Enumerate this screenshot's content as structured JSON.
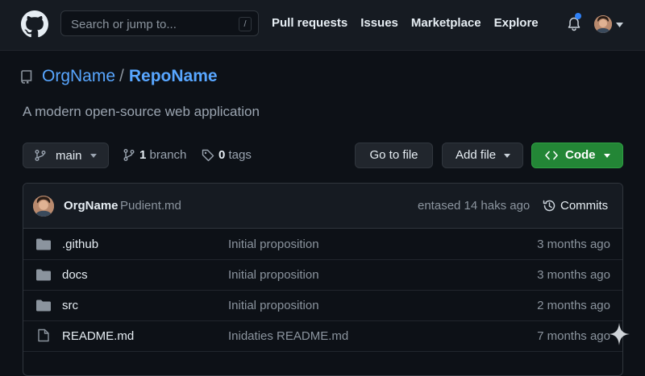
{
  "topbar": {
    "search_placeholder": "Search or jump to...",
    "search_shortcut": "/",
    "nav": [
      "Pull requests",
      "Issues",
      "Marketplace",
      "Explore"
    ]
  },
  "repo": {
    "owner": "OrgName",
    "separator": "/",
    "name": "RepoName",
    "description": "A modern open-source web application"
  },
  "toolbar": {
    "branch": "main",
    "branch_count": "1",
    "branch_label": "branch",
    "tag_count": "0",
    "tag_label": "tags",
    "go_to_file": "Go to file",
    "add_file": "Add file",
    "code": "Code"
  },
  "commit": {
    "author": "OrgName",
    "message": "Pudient.md",
    "time": "entased 14 haks ago",
    "commits_link": "Commits"
  },
  "files": [
    {
      "name": ".github",
      "type": "folder",
      "message": "Initial proposition",
      "age": "3 months ago"
    },
    {
      "name": "docs",
      "type": "folder",
      "message": "Initial proposition",
      "age": "3 months ago"
    },
    {
      "name": "src",
      "type": "folder",
      "message": "Initial proposition",
      "age": "2 months ago"
    },
    {
      "name": "README.md",
      "type": "file",
      "message": "Inidaties README.md",
      "age": "7 months ago"
    }
  ],
  "colors": {
    "background": "#0d1117",
    "link": "#58a6ff",
    "code_button": "#238636",
    "notification_dot": "#2f81f7"
  },
  "icons": {
    "logo": "github-logo-icon",
    "bell": "bell-icon",
    "repo": "repo-icon",
    "branch": "git-branch-icon",
    "tag": "tag-icon",
    "code": "code-icon",
    "history": "history-icon",
    "folder": "folder-icon",
    "file": "file-icon",
    "sparkle": "sparkle-icon"
  }
}
